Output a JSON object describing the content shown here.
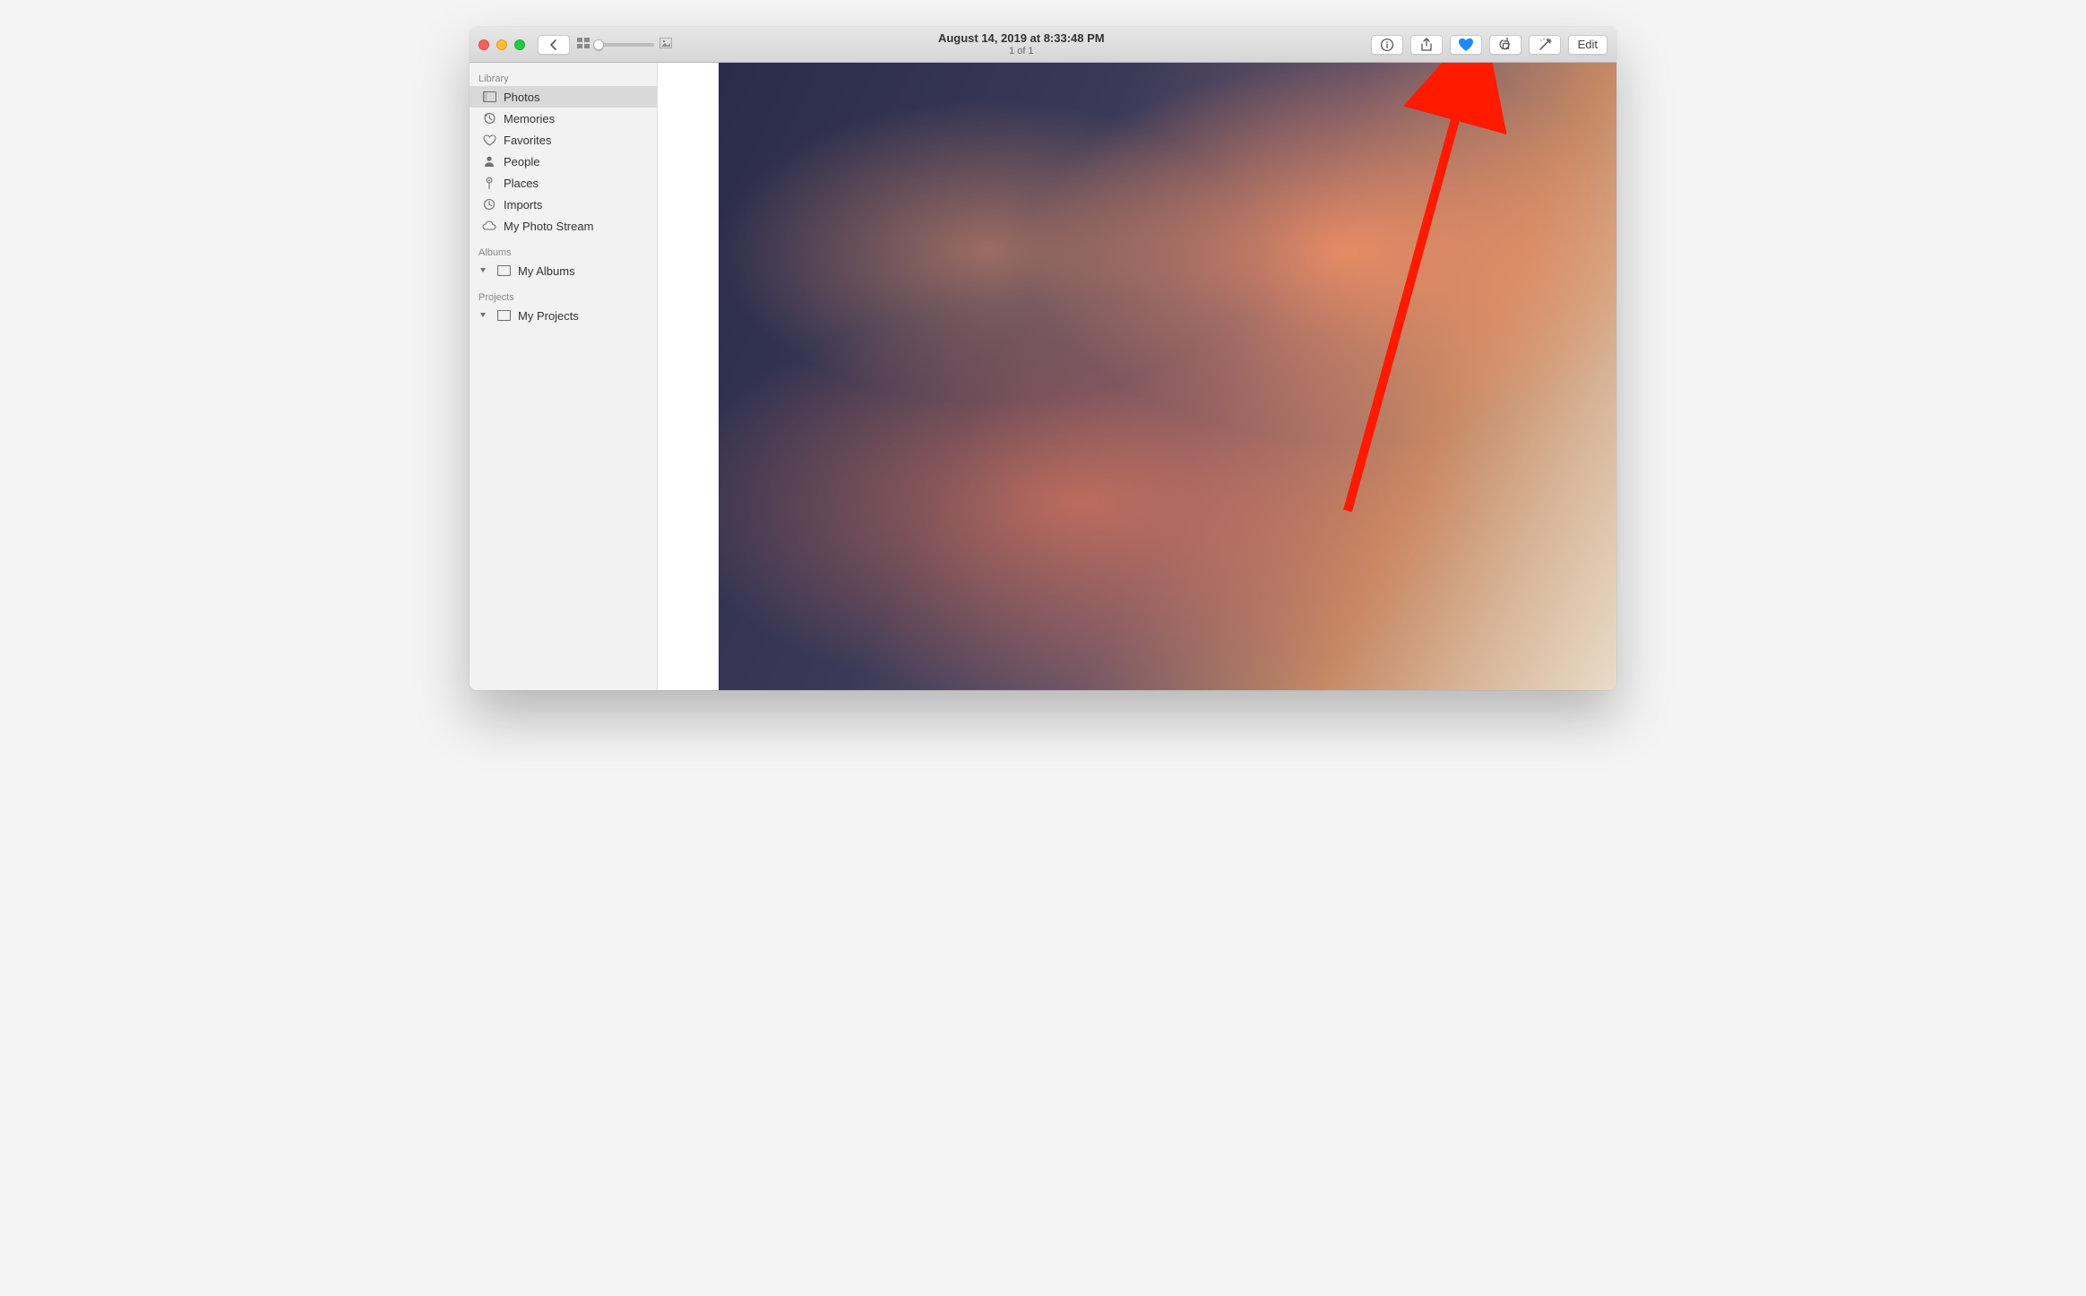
{
  "toolbar": {
    "title": "August 14, 2019 at 8:33:48 PM",
    "subtitle": "1 of 1",
    "edit_label": "Edit"
  },
  "sidebar": {
    "sections": {
      "library_label": "Library",
      "albums_label": "Albums",
      "projects_label": "Projects"
    },
    "library": [
      {
        "label": "Photos"
      },
      {
        "label": "Memories"
      },
      {
        "label": "Favorites"
      },
      {
        "label": "People"
      },
      {
        "label": "Places"
      },
      {
        "label": "Imports"
      },
      {
        "label": "My Photo Stream"
      }
    ],
    "albums_item": "My Albums",
    "projects_item": "My Projects"
  },
  "colors": {
    "accent_blue": "#1e88ff",
    "annotation_red": "#ff1a00"
  }
}
